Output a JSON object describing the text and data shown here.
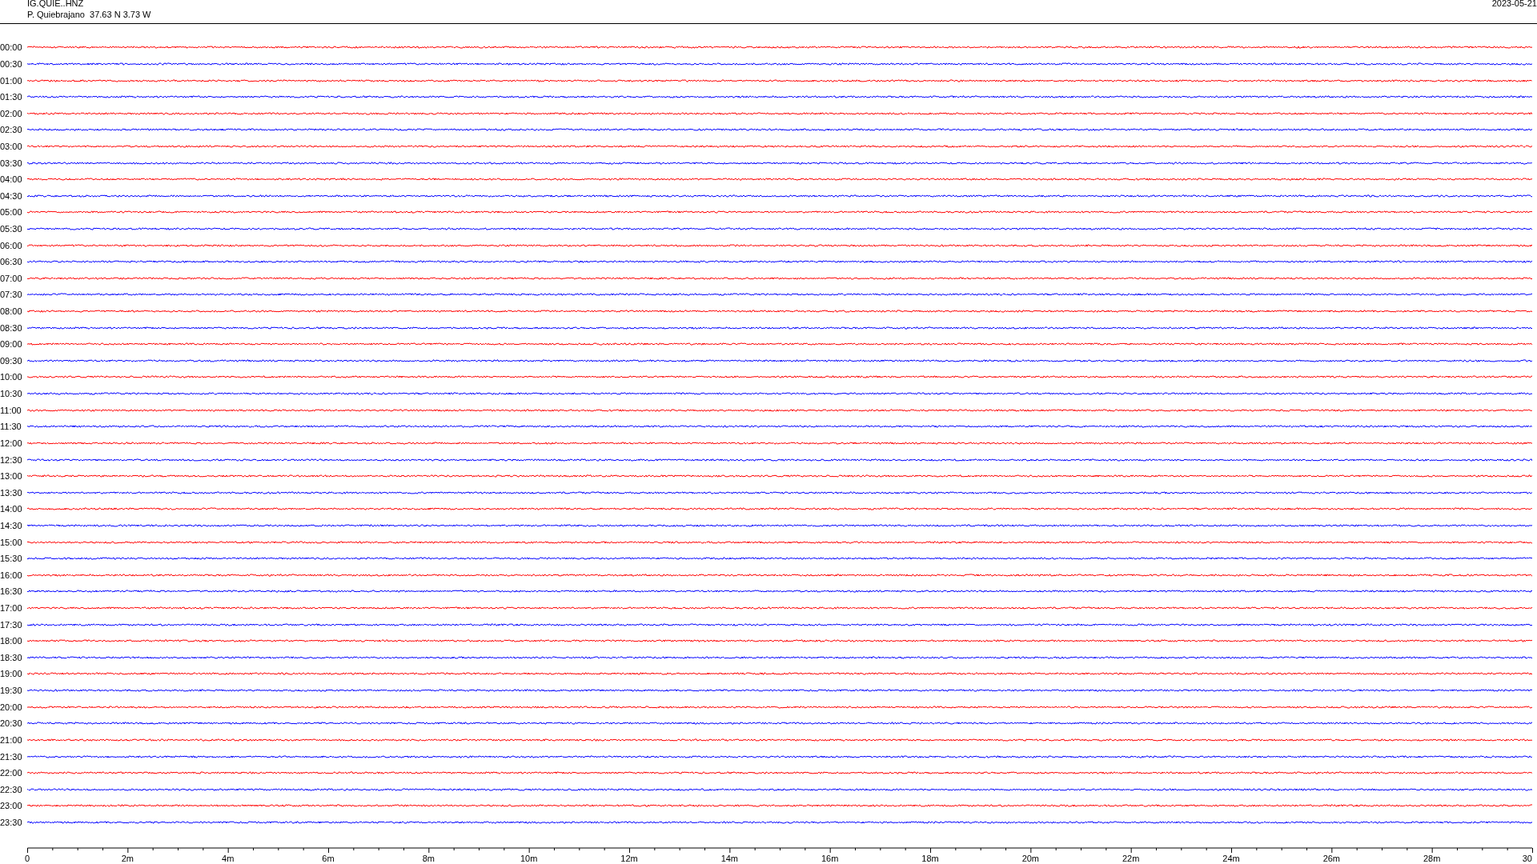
{
  "header": {
    "station": "IG.QUIE..HNZ",
    "location": "P. Quiebrajano  37.63 N 3.73 W",
    "date": "2023-05-21"
  },
  "rows": [
    {
      "time": "00:00",
      "color": "#ff0000"
    },
    {
      "time": "00:30",
      "color": "#0000ff"
    },
    {
      "time": "01:00",
      "color": "#ff0000"
    },
    {
      "time": "01:30",
      "color": "#0000ff"
    },
    {
      "time": "02:00",
      "color": "#ff0000"
    },
    {
      "time": "02:30",
      "color": "#0000ff"
    },
    {
      "time": "03:00",
      "color": "#ff0000"
    },
    {
      "time": "03:30",
      "color": "#0000ff"
    },
    {
      "time": "04:00",
      "color": "#ff0000"
    },
    {
      "time": "04:30",
      "color": "#0000ff"
    },
    {
      "time": "05:00",
      "color": "#ff0000"
    },
    {
      "time": "05:30",
      "color": "#0000ff"
    },
    {
      "time": "06:00",
      "color": "#ff0000"
    },
    {
      "time": "06:30",
      "color": "#0000ff"
    },
    {
      "time": "07:00",
      "color": "#ff0000"
    },
    {
      "time": "07:30",
      "color": "#0000ff"
    },
    {
      "time": "08:00",
      "color": "#ff0000"
    },
    {
      "time": "08:30",
      "color": "#0000ff"
    },
    {
      "time": "09:00",
      "color": "#ff0000"
    },
    {
      "time": "09:30",
      "color": "#0000ff"
    },
    {
      "time": "10:00",
      "color": "#ff0000"
    },
    {
      "time": "10:30",
      "color": "#0000ff"
    },
    {
      "time": "11:00",
      "color": "#ff0000"
    },
    {
      "time": "11:30",
      "color": "#0000ff"
    },
    {
      "time": "12:00",
      "color": "#ff0000"
    },
    {
      "time": "12:30",
      "color": "#0000ff"
    },
    {
      "time": "13:00",
      "color": "#ff0000"
    },
    {
      "time": "13:30",
      "color": "#0000ff"
    },
    {
      "time": "14:00",
      "color": "#ff0000"
    },
    {
      "time": "14:30",
      "color": "#0000ff"
    },
    {
      "time": "15:00",
      "color": "#ff0000"
    },
    {
      "time": "15:30",
      "color": "#0000ff"
    },
    {
      "time": "16:00",
      "color": "#ff0000"
    },
    {
      "time": "16:30",
      "color": "#0000ff"
    },
    {
      "time": "17:00",
      "color": "#ff0000"
    },
    {
      "time": "17:30",
      "color": "#0000ff"
    },
    {
      "time": "18:00",
      "color": "#ff0000"
    },
    {
      "time": "18:30",
      "color": "#0000ff"
    },
    {
      "time": "19:00",
      "color": "#ff0000"
    },
    {
      "time": "19:30",
      "color": "#0000ff"
    },
    {
      "time": "20:00",
      "color": "#ff0000"
    },
    {
      "time": "20:30",
      "color": "#0000ff"
    },
    {
      "time": "21:00",
      "color": "#ff0000"
    },
    {
      "time": "21:30",
      "color": "#0000ff"
    },
    {
      "time": "22:00",
      "color": "#ff0000"
    },
    {
      "time": "22:30",
      "color": "#0000ff"
    },
    {
      "time": "23:00",
      "color": "#ff0000"
    },
    {
      "time": "23:30",
      "color": "#0000ff"
    }
  ],
  "axis_labels": [
    "0",
    "2m",
    "4m",
    "6m",
    "8m",
    "10m",
    "12m",
    "14m",
    "16m",
    "18m",
    "20m",
    "22m",
    "24m",
    "26m",
    "28m",
    "30"
  ]
}
